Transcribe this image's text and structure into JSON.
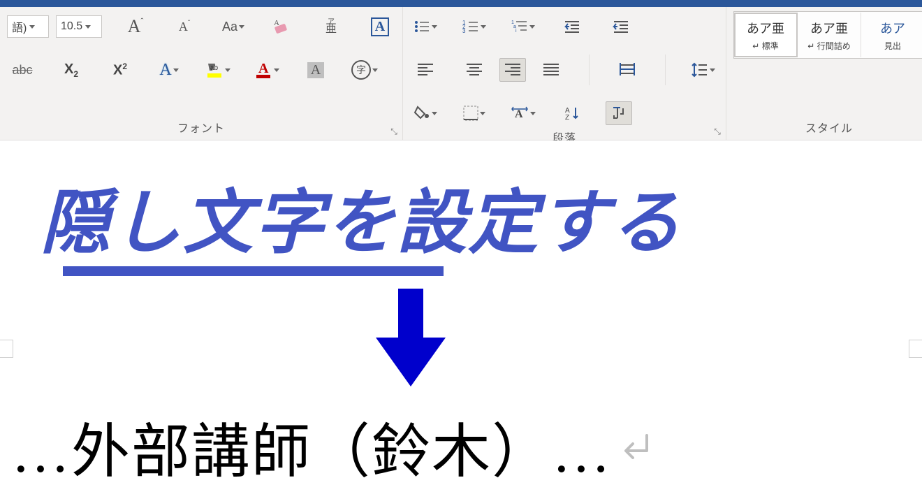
{
  "ribbon": {
    "font_group_label": "フォント",
    "paragraph_group_label": "段落",
    "style_group_label": "スタイル",
    "font_name_value": "語)",
    "font_size_value": "10.5",
    "styles": [
      {
        "preview": "あア亜",
        "name": "標準"
      },
      {
        "preview": "あア亜",
        "name": "行間詰め"
      },
      {
        "preview": "あア",
        "name": "見出"
      }
    ]
  },
  "overlay": {
    "title_text": "隠し文字を設定する"
  },
  "document": {
    "line_text": "…外部講師（鈴木）…",
    "paragraph_mark": "↵"
  }
}
